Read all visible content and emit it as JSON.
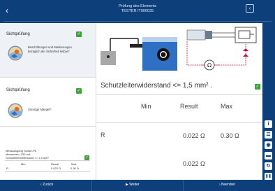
{
  "header": {
    "back_icon": "chevron-left-icon",
    "title_line1": "Prüfung des Elements",
    "title_line2": "TESTER IT000025",
    "collapse_icon": "panel-toggle-icon"
  },
  "sidebar": {
    "cards": [
      {
        "title": "Sichtprüfung",
        "checked": true,
        "question": "Beschriftungen und Markierungen bezüglich der Sicherheit lesbar?"
      },
      {
        "title": "Sichtprüfung",
        "checked": true,
        "question": "Sonstige Mängel?"
      }
    ],
    "summary": {
      "line1": "Messausgang  Sonde-PE",
      "line2": "Messstrom:  200 mA",
      "line3": "Schutzleiterwiderstand <= 1,5 mm²",
      "col_min": "Min",
      "col_result": "Result",
      "col_max": "Max",
      "row_label": "R",
      "row_result": "0.022 Ω",
      "row_max": "0.30 Ω"
    }
  },
  "main": {
    "heading": "Schutzleiterwiderstand <= 1,5 mm² .",
    "col_min": "Min",
    "col_result": "Result",
    "col_max": "Max",
    "row_label": "R",
    "row_result": "0.022 Ω",
    "row_max": "0.30 Ω",
    "second_result": "0.022 Ω",
    "ohm_symbol": "Ω"
  },
  "toolbar": {
    "icons": [
      "info-icon",
      "list-icon",
      "camera-icon",
      "folder-icon",
      "refresh-icon",
      "pause-icon"
    ],
    "glyphs": [
      "i",
      "☰",
      "◉",
      "▬",
      "↻",
      "❚❚"
    ]
  },
  "footer": {
    "back_label": "Zurück",
    "next_label": "Weiter",
    "finish_label": "Beenden"
  },
  "colors": {
    "brand": "#0d3f7a",
    "check": "#3aa63a",
    "device": "#2f6fc4",
    "wire_red": "#c8102e"
  }
}
